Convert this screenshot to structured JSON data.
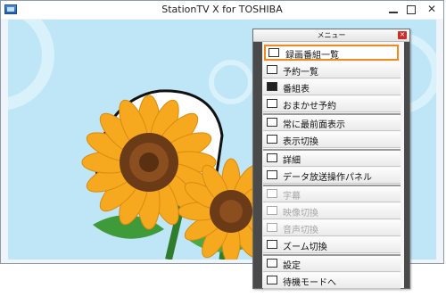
{
  "window": {
    "title": "StationTV X for TOSHIBA"
  },
  "menu": {
    "title": "メニュー",
    "items": [
      {
        "label": "録画番組一覧",
        "icon": "recorded-list-icon",
        "selected": true,
        "disabled": false
      },
      {
        "label": "予約一覧",
        "icon": "reservation-list-icon",
        "selected": false,
        "disabled": false
      },
      {
        "label": "番組表",
        "icon": "program-guide-icon",
        "selected": false,
        "disabled": false
      },
      {
        "label": "おまかせ予約",
        "icon": "auto-reservation-icon",
        "selected": false,
        "disabled": false
      },
      {
        "label": "常に最前面表示",
        "icon": "always-on-top-icon",
        "selected": false,
        "disabled": false
      },
      {
        "label": "表示切換",
        "icon": "display-switch-icon",
        "selected": false,
        "disabled": false
      },
      {
        "label": "詳細",
        "icon": "info-icon",
        "selected": false,
        "disabled": false
      },
      {
        "label": "データ放送操作パネル",
        "icon": "data-broadcast-panel-icon",
        "selected": false,
        "disabled": false
      },
      {
        "label": "字幕",
        "icon": "subtitle-icon",
        "selected": false,
        "disabled": true
      },
      {
        "label": "映像切換",
        "icon": "video-switch-icon",
        "selected": false,
        "disabled": true
      },
      {
        "label": "音声切換",
        "icon": "audio-switch-icon",
        "selected": false,
        "disabled": true
      },
      {
        "label": "ズーム切換",
        "icon": "zoom-switch-icon",
        "selected": false,
        "disabled": false
      },
      {
        "label": "設定",
        "icon": "settings-icon",
        "selected": false,
        "disabled": false
      },
      {
        "label": "待機モードへ",
        "icon": "standby-icon",
        "selected": false,
        "disabled": false
      }
    ]
  },
  "colors": {
    "selection_border": "#f08a1c",
    "sky": "#bfe6f7",
    "petal": "#f6a81e",
    "center": "#6b3a17",
    "leaf": "#3f9a3a"
  }
}
